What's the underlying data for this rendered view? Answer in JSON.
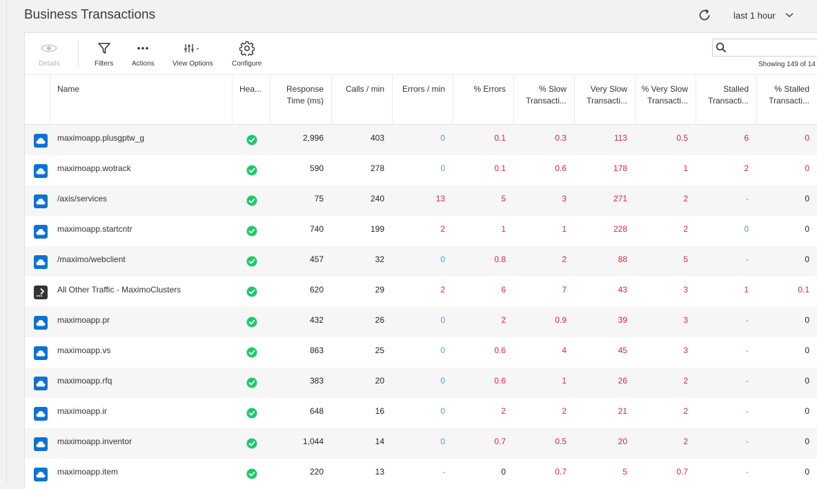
{
  "header": {
    "title": "Business Transactions",
    "time_range": "last 1 hour",
    "refresh_icon": "refresh-icon",
    "time_range_icon": "chevron-down-icon"
  },
  "toolbar": {
    "details": {
      "label": "Details",
      "icon": "eye-icon",
      "disabled": true
    },
    "filters": {
      "label": "Filters",
      "icon": "filter-icon"
    },
    "actions": {
      "label": "Actions",
      "icon": "ellipsis-icon"
    },
    "view_options": {
      "label": "View Options",
      "icon": "sliders-icon"
    },
    "configure": {
      "label": "Configure",
      "icon": "gear-icon"
    },
    "search": {
      "placeholder": "",
      "value": "",
      "icon": "search-icon"
    },
    "showing_text": "Showing 149 of 14"
  },
  "table": {
    "columns": [
      {
        "key": "name",
        "label": "Name"
      },
      {
        "key": "health",
        "label": "Hea..."
      },
      {
        "key": "response_time",
        "label": "Response Time (ms)"
      },
      {
        "key": "calls_per_min",
        "label": "Calls / min"
      },
      {
        "key": "errors_per_min",
        "label": "Errors / min"
      },
      {
        "key": "pct_errors",
        "label": "% Errors"
      },
      {
        "key": "pct_slow",
        "label": "% Slow Transacti..."
      },
      {
        "key": "very_slow",
        "label": "Very Slow Transacti..."
      },
      {
        "key": "pct_very_slow",
        "label": "% Very Slow Transacti..."
      },
      {
        "key": "stalled",
        "label": "Stalled Transacti..."
      },
      {
        "key": "pct_stalled",
        "label": "% Stalled Transacti..."
      }
    ],
    "colors": {
      "blue": "#4a9be0",
      "red": "#e0243a",
      "dark": "#222222",
      "health_ok": "#1ec96b",
      "cloud_icon": "#0a73d6"
    },
    "rows": [
      {
        "type": "cloud",
        "name": "maximoapp.plusgptw_g",
        "health": "normal",
        "response_time": "2,996",
        "calls_per_min": "403",
        "errors_per_min": [
          "0",
          "blue"
        ],
        "pct_errors": [
          "0.1",
          "red"
        ],
        "pct_slow": [
          "0.3",
          "red"
        ],
        "very_slow": [
          "113",
          "red"
        ],
        "pct_very_slow": [
          "0.5",
          "red"
        ],
        "stalled": [
          "6",
          "red"
        ],
        "pct_stalled": [
          "0",
          "red"
        ]
      },
      {
        "type": "cloud",
        "name": "maximoapp.wotrack",
        "health": "normal",
        "response_time": "590",
        "calls_per_min": "278",
        "errors_per_min": [
          "0",
          "blue"
        ],
        "pct_errors": [
          "0.1",
          "red"
        ],
        "pct_slow": [
          "0.6",
          "red"
        ],
        "very_slow": [
          "178",
          "red"
        ],
        "pct_very_slow": [
          "1",
          "red"
        ],
        "stalled": [
          "2",
          "red"
        ],
        "pct_stalled": [
          "0",
          "red"
        ]
      },
      {
        "type": "cloud",
        "name": "/axis/services",
        "health": "normal",
        "response_time": "75",
        "calls_per_min": "240",
        "errors_per_min": [
          "13",
          "red"
        ],
        "pct_errors": [
          "5",
          "red"
        ],
        "pct_slow": [
          "3",
          "red"
        ],
        "very_slow": [
          "271",
          "red"
        ],
        "pct_very_slow": [
          "2",
          "red"
        ],
        "stalled": [
          "-",
          "blue"
        ],
        "pct_stalled": [
          "0",
          "dark"
        ]
      },
      {
        "type": "cloud",
        "name": "maximoapp.startcntr",
        "health": "normal",
        "response_time": "740",
        "calls_per_min": "199",
        "errors_per_min": [
          "2",
          "red"
        ],
        "pct_errors": [
          "1",
          "red"
        ],
        "pct_slow": [
          "1",
          "red"
        ],
        "very_slow": [
          "228",
          "red"
        ],
        "pct_very_slow": [
          "2",
          "red"
        ],
        "stalled": [
          "0",
          "blue"
        ],
        "pct_stalled": [
          "0",
          "dark"
        ]
      },
      {
        "type": "cloud",
        "name": "/maximo/webclient",
        "health": "normal",
        "response_time": "457",
        "calls_per_min": "32",
        "errors_per_min": [
          "0",
          "blue"
        ],
        "pct_errors": [
          "0.8",
          "red"
        ],
        "pct_slow": [
          "2",
          "red"
        ],
        "very_slow": [
          "88",
          "red"
        ],
        "pct_very_slow": [
          "5",
          "red"
        ],
        "stalled": [
          "-",
          "blue"
        ],
        "pct_stalled": [
          "0",
          "dark"
        ]
      },
      {
        "type": "other",
        "name": "All Other Traffic - MaximoClusters",
        "health": "normal",
        "response_time": "620",
        "calls_per_min": "29",
        "errors_per_min": [
          "2",
          "red"
        ],
        "pct_errors": [
          "6",
          "red"
        ],
        "pct_slow": [
          "7",
          "red"
        ],
        "very_slow": [
          "43",
          "red"
        ],
        "pct_very_slow": [
          "3",
          "red"
        ],
        "stalled": [
          "1",
          "red"
        ],
        "pct_stalled": [
          "0.1",
          "red"
        ]
      },
      {
        "type": "cloud",
        "name": "maximoapp.pr",
        "health": "normal",
        "response_time": "432",
        "calls_per_min": "26",
        "errors_per_min": [
          "0",
          "blue"
        ],
        "pct_errors": [
          "2",
          "red"
        ],
        "pct_slow": [
          "0.9",
          "red"
        ],
        "very_slow": [
          "39",
          "red"
        ],
        "pct_very_slow": [
          "3",
          "red"
        ],
        "stalled": [
          "-",
          "blue"
        ],
        "pct_stalled": [
          "0",
          "dark"
        ]
      },
      {
        "type": "cloud",
        "name": "maximoapp.vs",
        "health": "normal",
        "response_time": "863",
        "calls_per_min": "25",
        "errors_per_min": [
          "0",
          "blue"
        ],
        "pct_errors": [
          "0.6",
          "red"
        ],
        "pct_slow": [
          "4",
          "red"
        ],
        "very_slow": [
          "45",
          "red"
        ],
        "pct_very_slow": [
          "3",
          "red"
        ],
        "stalled": [
          "-",
          "blue"
        ],
        "pct_stalled": [
          "0",
          "dark"
        ]
      },
      {
        "type": "cloud",
        "name": "maximoapp.rfq",
        "health": "normal",
        "response_time": "383",
        "calls_per_min": "20",
        "errors_per_min": [
          "0",
          "blue"
        ],
        "pct_errors": [
          "0.6",
          "red"
        ],
        "pct_slow": [
          "1",
          "red"
        ],
        "very_slow": [
          "26",
          "red"
        ],
        "pct_very_slow": [
          "2",
          "red"
        ],
        "stalled": [
          "-",
          "blue"
        ],
        "pct_stalled": [
          "0",
          "dark"
        ]
      },
      {
        "type": "cloud",
        "name": "maximoapp.ir",
        "health": "normal",
        "response_time": "648",
        "calls_per_min": "16",
        "errors_per_min": [
          "0",
          "blue"
        ],
        "pct_errors": [
          "2",
          "red"
        ],
        "pct_slow": [
          "2",
          "red"
        ],
        "very_slow": [
          "21",
          "red"
        ],
        "pct_very_slow": [
          "2",
          "red"
        ],
        "stalled": [
          "-",
          "blue"
        ],
        "pct_stalled": [
          "0",
          "dark"
        ]
      },
      {
        "type": "cloud",
        "name": "maximoapp.inventor",
        "health": "normal",
        "response_time": "1,044",
        "calls_per_min": "14",
        "errors_per_min": [
          "0",
          "blue"
        ],
        "pct_errors": [
          "0.7",
          "red"
        ],
        "pct_slow": [
          "0.5",
          "red"
        ],
        "very_slow": [
          "20",
          "red"
        ],
        "pct_very_slow": [
          "2",
          "red"
        ],
        "stalled": [
          "-",
          "blue"
        ],
        "pct_stalled": [
          "0",
          "dark"
        ]
      },
      {
        "type": "cloud",
        "name": "maximoapp.item",
        "health": "normal",
        "response_time": "220",
        "calls_per_min": "13",
        "errors_per_min": [
          "-",
          "blue"
        ],
        "pct_errors": [
          "0",
          "dark"
        ],
        "pct_slow": [
          "0.7",
          "red"
        ],
        "very_slow": [
          "5",
          "red"
        ],
        "pct_very_slow": [
          "0.7",
          "red"
        ],
        "stalled": [
          "-",
          "blue"
        ],
        "pct_stalled": [
          "0",
          "dark"
        ]
      }
    ]
  }
}
